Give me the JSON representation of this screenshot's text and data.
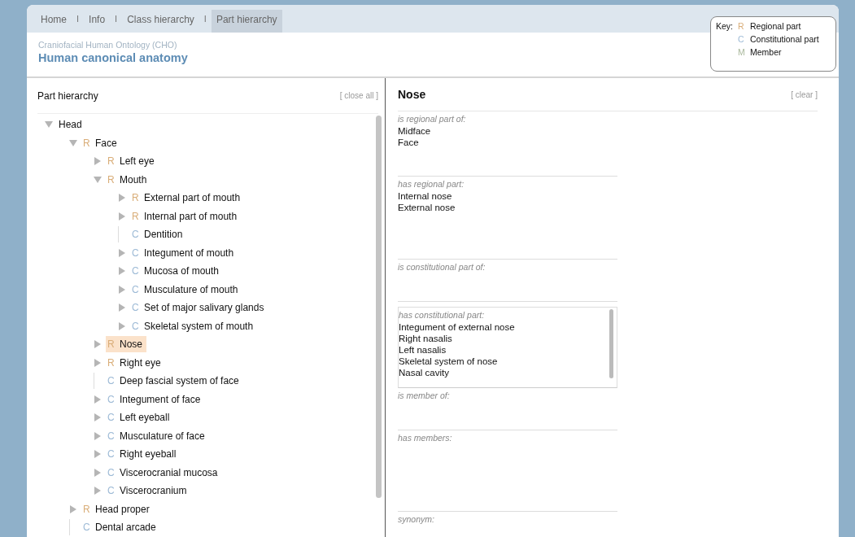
{
  "nav": {
    "tabs": [
      {
        "label": "Home",
        "selected": false
      },
      {
        "separator": "I",
        "label": "Info",
        "selected": false
      },
      {
        "separator": "I",
        "label": "Class hierarchy",
        "selected": false
      },
      {
        "separator": "I",
        "label": "Part hierarchy",
        "selected": true
      }
    ]
  },
  "header": {
    "subtitle": "Craniofacial Human Ontology (CHO)",
    "title": "Human canonical anatomy"
  },
  "key": {
    "label": "Key:",
    "items": [
      {
        "letter": "R",
        "label": "Regional part",
        "color": "#d9ad78"
      },
      {
        "letter": "C",
        "label": "Constitutional part",
        "color": "#9dbad6"
      },
      {
        "letter": "M",
        "label": "Member",
        "color": "#a9b89c"
      }
    ]
  },
  "tree_panel": {
    "title": "Part hierarchy",
    "close_all": "[ close all ]",
    "items": [
      {
        "label": "Head",
        "expanded": true,
        "selected": false,
        "children": [
          {
            "letter": "R",
            "kind": "regional",
            "label": "Face",
            "expanded": true,
            "selected": false,
            "children": [
              {
                "letter": "R",
                "kind": "regional",
                "label": "Left eye",
                "expanded": false,
                "selected": false
              },
              {
                "letter": "R",
                "kind": "regional",
                "label": "Mouth",
                "expanded": true,
                "selected": false,
                "children": [
                  {
                    "letter": "R",
                    "kind": "regional",
                    "label": "External part of mouth",
                    "expanded": false,
                    "selected": false
                  },
                  {
                    "letter": "R",
                    "kind": "regional",
                    "label": "Internal part of mouth",
                    "expanded": false,
                    "selected": false
                  },
                  {
                    "letter": "C",
                    "kind": "constitutional",
                    "label": "Dentition",
                    "selected": false
                  },
                  {
                    "letter": "C",
                    "kind": "constitutional",
                    "label": "Integument of mouth",
                    "expanded": false,
                    "selected": false
                  },
                  {
                    "letter": "C",
                    "kind": "constitutional",
                    "label": "Mucosa of mouth",
                    "expanded": false,
                    "selected": false
                  },
                  {
                    "letter": "C",
                    "kind": "constitutional",
                    "label": "Musculature of mouth",
                    "expanded": false,
                    "selected": false
                  },
                  {
                    "letter": "C",
                    "kind": "constitutional",
                    "label": "Set of major salivary glands",
                    "expanded": false,
                    "selected": false
                  },
                  {
                    "letter": "C",
                    "kind": "constitutional",
                    "label": "Skeletal system of mouth",
                    "expanded": false,
                    "selected": false
                  }
                ]
              },
              {
                "letter": "R",
                "kind": "regional",
                "label": "Nose",
                "expanded": false,
                "selected": true
              },
              {
                "letter": "R",
                "kind": "regional",
                "label": "Right eye",
                "expanded": false,
                "selected": false
              },
              {
                "letter": "C",
                "kind": "constitutional",
                "label": "Deep fascial system of face",
                "selected": false
              },
              {
                "letter": "C",
                "kind": "constitutional",
                "label": "Integument of face",
                "expanded": false,
                "selected": false
              },
              {
                "letter": "C",
                "kind": "constitutional",
                "label": "Left eyeball",
                "expanded": false,
                "selected": false
              },
              {
                "letter": "C",
                "kind": "constitutional",
                "label": "Musculature of face",
                "expanded": false,
                "selected": false
              },
              {
                "letter": "C",
                "kind": "constitutional",
                "label": "Right eyeball",
                "expanded": false,
                "selected": false
              },
              {
                "letter": "C",
                "kind": "constitutional",
                "label": "Viscerocranial mucosa",
                "expanded": false,
                "selected": false
              },
              {
                "letter": "C",
                "kind": "constitutional",
                "label": "Viscerocranium",
                "expanded": false,
                "selected": false
              }
            ]
          },
          {
            "letter": "R",
            "kind": "regional",
            "label": "Head proper",
            "expanded": false,
            "selected": false
          },
          {
            "letter": "C",
            "kind": "constitutional",
            "label": "Dental arcade",
            "selected": false
          }
        ]
      }
    ]
  },
  "detail_panel": {
    "title": "Nose",
    "clear": "[ clear ]",
    "sections": [
      {
        "label": "is regional part of:",
        "values": [
          "Midface",
          "Face"
        ]
      },
      {
        "label": "has regional part:",
        "values": [
          "Internal nose",
          "External nose"
        ]
      },
      {
        "label": "is constitutional part of:"
      },
      {
        "label": "has constitutional part:",
        "scrollable": true,
        "values": [
          "Integument of external nose",
          "Right nasalis",
          "Left nasalis",
          "Skeletal system of nose",
          "Nasal cavity"
        ]
      },
      {
        "label": "is member of:"
      },
      {
        "label": "has members:"
      },
      {
        "label": "synonym:"
      }
    ]
  }
}
